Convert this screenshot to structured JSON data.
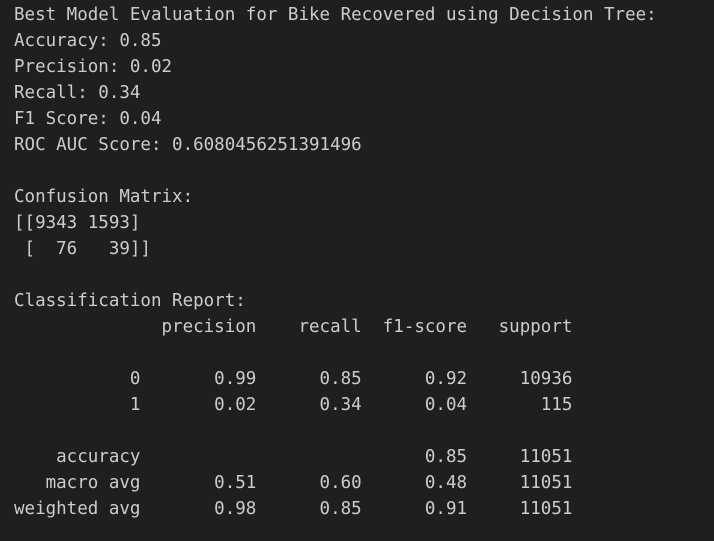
{
  "output": {
    "header": "Best Model Evaluation for Bike Recovered using Decision Tree:",
    "accuracy": "Accuracy: 0.85",
    "precision": "Precision: 0.02",
    "recall": "Recall: 0.34",
    "f1": "F1 Score: 0.04",
    "roc_auc": "ROC AUC Score: 0.6080456251391496",
    "confusion_title": "Confusion Matrix:",
    "confusion_row_0": "[[9343 1593]",
    "confusion_row_1": " [  76   39]]",
    "report_title": "Classification Report:",
    "report_header": "              precision    recall  f1-score   support",
    "report_row_0": "           0       0.99      0.85      0.92     10936",
    "report_row_1": "           1       0.02      0.34      0.04       115",
    "report_accuracy": "    accuracy                           0.85     11051",
    "report_macro": "   macro avg       0.51      0.60      0.48     11051",
    "report_weighted": "weighted avg       0.98      0.85      0.91     11051"
  }
}
